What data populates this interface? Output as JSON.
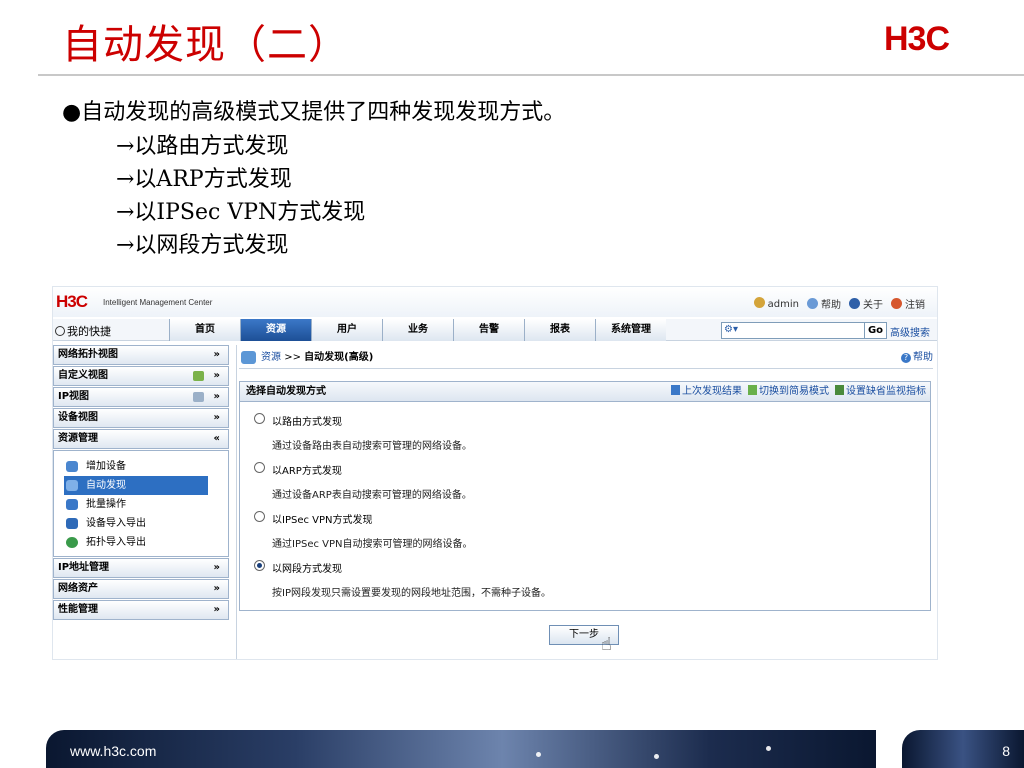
{
  "slide": {
    "title": "自动发现（二）",
    "brand": "H3C",
    "bullet_dot": "●",
    "bullet": "自动发现的高级模式又提供了四种发现发现方式。",
    "sub_items": [
      "→以路由方式发现",
      "→以ARP方式发现",
      "→以IPSec VPN方式发现",
      "→以网段方式发现"
    ],
    "footer_url": "www.h3c.com",
    "page_number": "8"
  },
  "app": {
    "logo": "H3C",
    "logo_sub": "Intelligent Management Center",
    "top_links": {
      "user": "admin",
      "help": "帮助",
      "about": "关于",
      "logout": "注销"
    },
    "shortcut": "我的快捷",
    "nav_tabs": [
      "首页",
      "资源",
      "用户",
      "业务",
      "告警",
      "报表",
      "系统管理"
    ],
    "active_tab": "资源",
    "search": {
      "value": "",
      "go": "Go",
      "advanced": "高级搜索"
    },
    "sidebar": {
      "headers_top": [
        "网络拓扑视图",
        "自定义视图",
        "IP视图",
        "设备视图",
        "资源管理"
      ],
      "resource_items": [
        "增加设备",
        "自动发现",
        "批量操作",
        "设备导入导出",
        "拓扑导入导出"
      ],
      "active_item": "自动发现",
      "headers_bottom": [
        "IP地址管理",
        "网络资产",
        "性能管理"
      ],
      "chevron_down": "»",
      "chevron_up": "«"
    },
    "breadcrumb": {
      "link": "资源",
      "separator": ">>",
      "current": "自动发现(高级)"
    },
    "help": "帮助",
    "panel": {
      "title": "选择自动发现方式",
      "links": [
        "上次发现结果",
        "切换到简易模式",
        "设置缺省监视指标"
      ],
      "options": [
        {
          "label": "以路由方式发现",
          "desc": "通过设备路由表自动搜索可管理的网络设备。",
          "selected": false
        },
        {
          "label": "以ARP方式发现",
          "desc": "通过设备ARP表自动搜索可管理的网络设备。",
          "selected": false
        },
        {
          "label": "以IPSec VPN方式发现",
          "desc": "通过IPSec VPN自动搜索可管理的网络设备。",
          "selected": false
        },
        {
          "label": "以网段方式发现",
          "desc": "按IP网段发现只需设置要发现的网段地址范围，不需种子设备。",
          "selected": true
        }
      ]
    },
    "next_button": "下一步"
  }
}
